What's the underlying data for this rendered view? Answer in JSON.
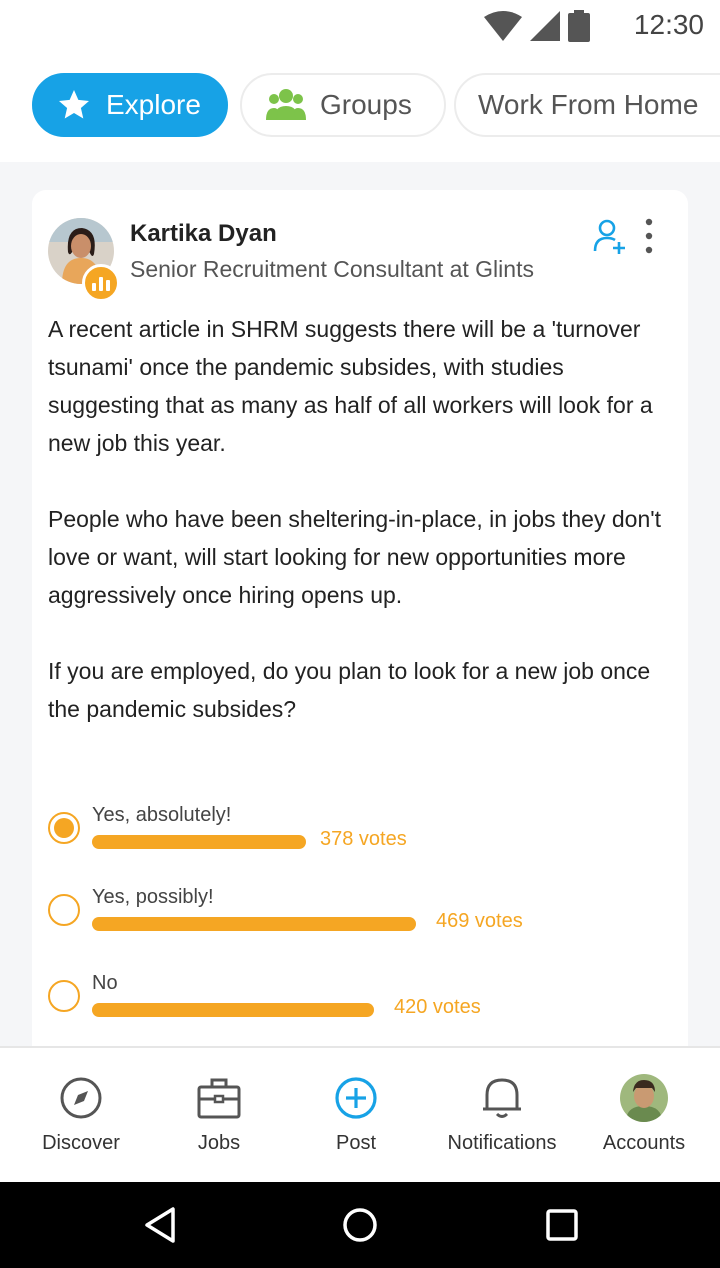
{
  "status_bar": {
    "time": "12:30",
    "icons": [
      "wifi-icon",
      "signal-icon",
      "battery-icon"
    ]
  },
  "chips": [
    {
      "label": "Explore",
      "icon": "star-icon",
      "active": true
    },
    {
      "label": "Groups",
      "icon": "groups-icon",
      "active": false
    },
    {
      "label": "Work From Home",
      "active": false
    }
  ],
  "post": {
    "author": {
      "name": "Kartika Dyan",
      "title": "Senior Recruitment Consultant at Glints"
    },
    "paragraphs": [
      "A recent article in SHRM suggests there will be a 'turnover tsunami' once the pandemic subsides, with studies suggesting that as many as half of all workers will look for a new job this year.",
      "People who have been sheltering-in-place, in jobs they don't love or want, will start looking for new opportunities more aggressively once hiring opens up.",
      "If you are employed, do you plan to look for a new job once the pandemic subsides?"
    ],
    "poll": {
      "options": [
        {
          "label": "Yes, absolutely!",
          "votes_text": "378 votes",
          "votes": 378,
          "selected": true
        },
        {
          "label": "Yes, possibly!",
          "votes_text": "469 votes",
          "votes": 469,
          "selected": false
        },
        {
          "label": "No",
          "votes_text": "420 votes",
          "votes": 420,
          "selected": false
        }
      ]
    }
  },
  "bottom_nav": [
    {
      "label": "Discover",
      "icon": "compass-icon"
    },
    {
      "label": "Jobs",
      "icon": "briefcase-icon"
    },
    {
      "label": "Post",
      "icon": "plus-circle-icon",
      "active": true
    },
    {
      "label": "Notifications",
      "icon": "bell-icon"
    },
    {
      "label": "Accounts",
      "icon": "avatar"
    }
  ],
  "colors": {
    "accent": "#17a2e6",
    "poll": "#f5a623",
    "groups_icon": "#7dc34a"
  }
}
